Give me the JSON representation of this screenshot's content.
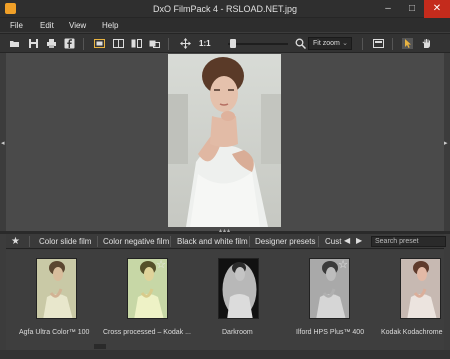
{
  "window": {
    "title": "DxO FilmPack 4 - RSLOAD.NET.jpg",
    "minimize": "–",
    "maximize": "□",
    "close": "✕"
  },
  "menu": [
    "File",
    "Edit",
    "View",
    "Help"
  ],
  "toolbar": {
    "zoom_label": "1:1",
    "zoom_level": 0.05,
    "fit_value": "Fit zoom",
    "icons": [
      "open-folder-icon",
      "save-icon",
      "print-icon",
      "facebook-icon",
      "compare-view-icon",
      "split-view-icon",
      "before-after-icon",
      "side-by-side-icon",
      "move-icon",
      "search-icon",
      "preview-window-icon",
      "select-arrow-icon",
      "hand-tool-icon"
    ]
  },
  "preset_tabs": {
    "tabs": [
      "Color slide film",
      "Color negative film",
      "Black and white film",
      "Designer presets",
      "Cust"
    ],
    "search_placeholder": "Search preset"
  },
  "thumbnails": [
    {
      "label": "Agfa Ultra Color™ 100",
      "favorite": false,
      "tone": "sepia-green"
    },
    {
      "label": "Cross processed – Kodak ...",
      "favorite": true,
      "tone": "cross"
    },
    {
      "label": "Darkroom",
      "favorite": false,
      "tone": "darkroom"
    },
    {
      "label": "Ilford HPS Plus™ 400",
      "favorite": true,
      "tone": "bw"
    },
    {
      "label": "Kodak Kodachrome",
      "favorite": false,
      "tone": "warm"
    }
  ],
  "colors": {
    "accent_close": "#c42b1c",
    "app_icon": "#f0a028",
    "workspace": "#4a4a4a"
  }
}
